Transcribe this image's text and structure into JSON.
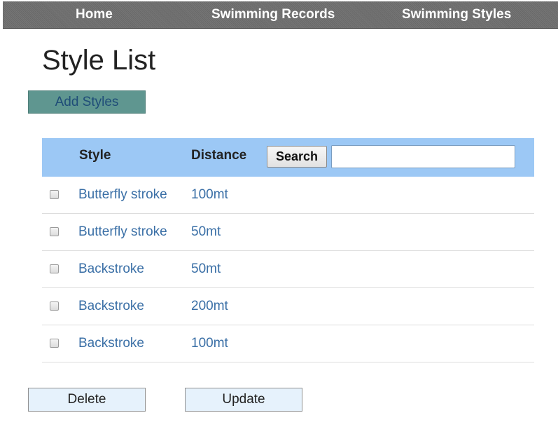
{
  "nav": {
    "home": "Home",
    "records": "Swimming Records",
    "styles": "Swimming Styles"
  },
  "page_title": "Style List",
  "add_button": "Add Styles",
  "table": {
    "headers": {
      "style": "Style",
      "distance": "Distance"
    },
    "search_button": "Search",
    "search_value": "",
    "rows": [
      {
        "style": "Butterfly stroke",
        "distance": "100mt",
        "checked": false
      },
      {
        "style": "Butterfly stroke",
        "distance": "50mt",
        "checked": false
      },
      {
        "style": "Backstroke",
        "distance": "50mt",
        "checked": false
      },
      {
        "style": "Backstroke",
        "distance": "200mt",
        "checked": false
      },
      {
        "style": "Backstroke",
        "distance": "100mt",
        "checked": false
      }
    ]
  },
  "actions": {
    "delete": "Delete",
    "update": "Update"
  },
  "colors": {
    "nav_background": "#6e6e6e",
    "table_header": "#9cc8f5",
    "link": "#3a6fa6",
    "add_button": "#5f9690",
    "action_button": "#e6f2fc"
  }
}
